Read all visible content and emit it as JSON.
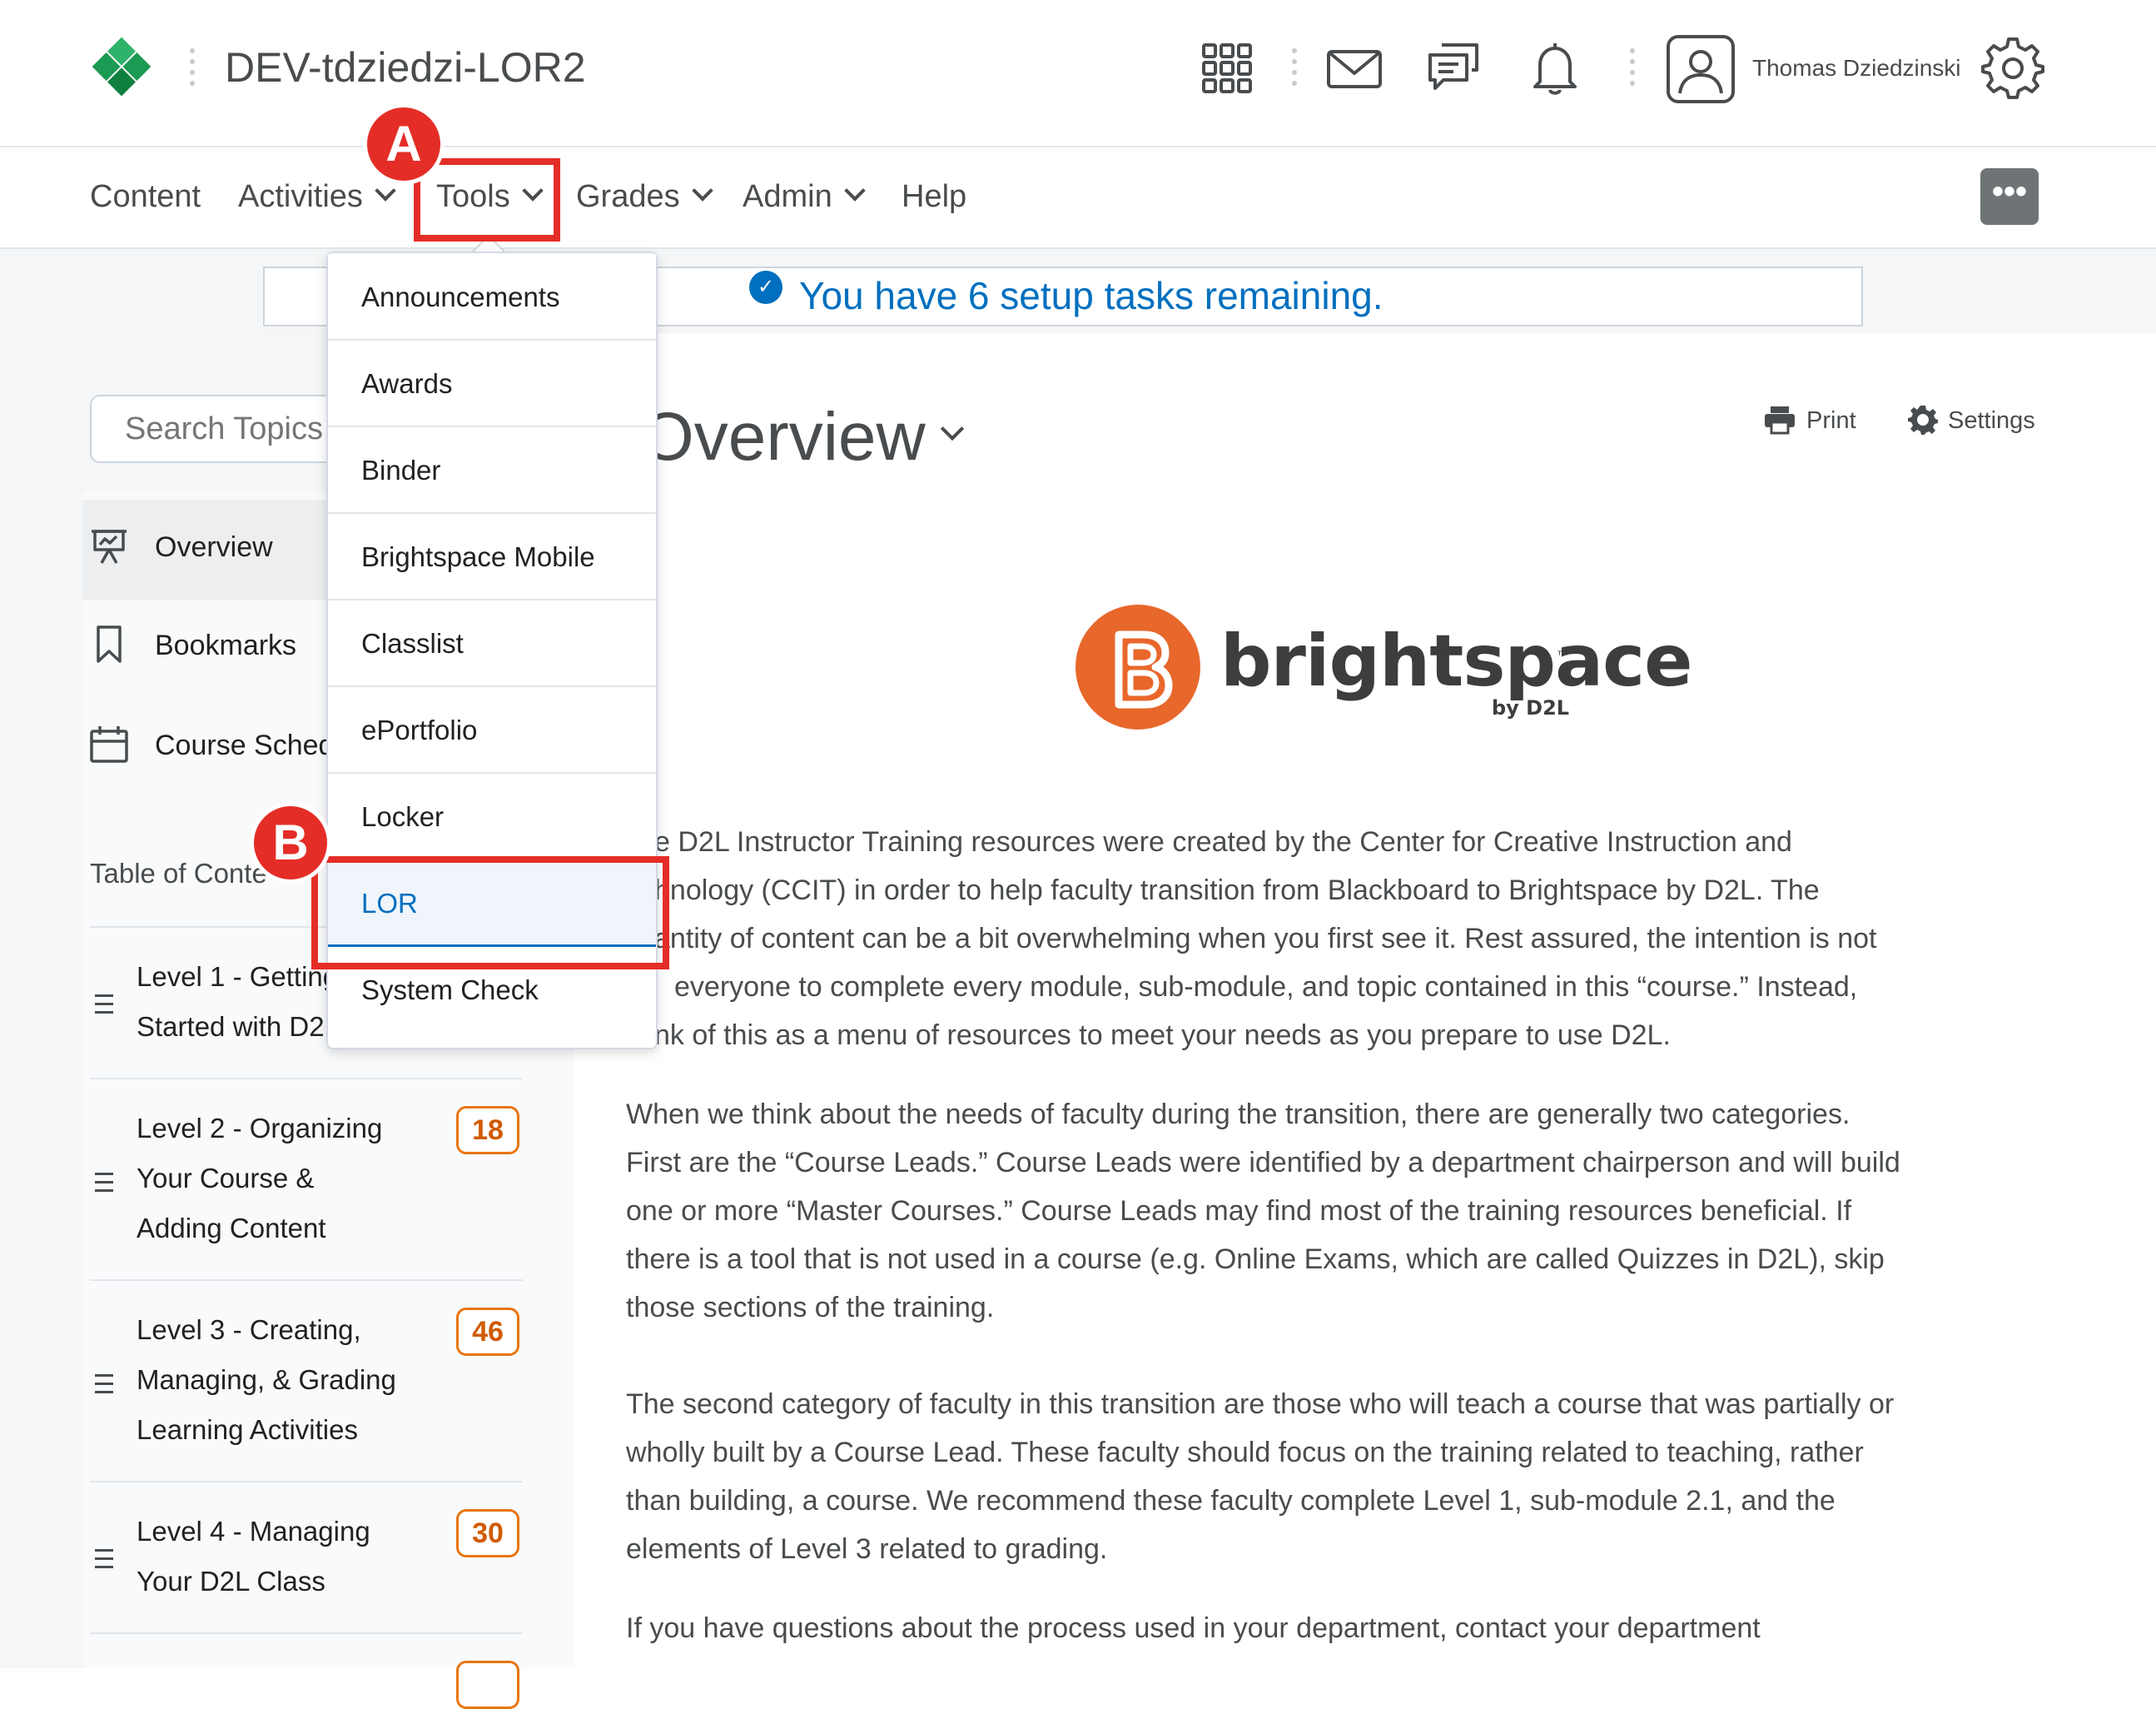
{
  "header": {
    "org_title": "DEV-tdziedzi-LOR2",
    "user_name": "Thomas Dziedzinski",
    "icons": [
      "waffle-icon",
      "mail-icon",
      "chat-icon",
      "bell-icon",
      "avatar-icon",
      "gear-icon"
    ]
  },
  "nav": {
    "items": [
      {
        "label": "Content"
      },
      {
        "label": "Activities"
      },
      {
        "label": "Tools"
      },
      {
        "label": "Grades"
      },
      {
        "label": "Admin"
      },
      {
        "label": "Help"
      }
    ],
    "more_label": "•••"
  },
  "setup_banner": {
    "text": "You have 6 setup tasks remaining."
  },
  "search": {
    "placeholder": "Search Topics"
  },
  "sidebar": {
    "items": [
      {
        "label": "Overview"
      },
      {
        "label": "Bookmarks"
      },
      {
        "label": "Course Schedu"
      }
    ],
    "toc_heading": "Table of Conte",
    "toc": [
      {
        "lines": [
          "Level 1 - Getting",
          "Started with D2"
        ],
        "count": ""
      },
      {
        "lines": [
          "Level 2 - Organizing",
          "Your Course &",
          "Adding Content"
        ],
        "count": "18"
      },
      {
        "lines": [
          "Level 3 - Creating,",
          "Managing, & Grading",
          "Learning Activities"
        ],
        "count": "46"
      },
      {
        "lines": [
          "Level 4 - Managing",
          "Your D2L Class"
        ],
        "count": "30"
      }
    ]
  },
  "main": {
    "heading": "Overview",
    "print_label": "Print",
    "settings_label": "Settings",
    "logo": {
      "word": "brightspace",
      "tm": "™",
      "byline": "by D2L"
    },
    "paragraphs": [
      [
        "e D2L Instructor Training resources were created by the Center for Creative Instruction and",
        "hnology (CCIT) in order to help faculty transition from Blackboard to Brightspace by D2L. The",
        "antity of content can be a bit overwhelming when you first see it. Rest assured, the intention is not",
        "everyone to complete every module, sub-module, and topic contained in this “course.” Instead,",
        "nk of this as a menu of resources to meet your needs as you prepare to use D2L."
      ],
      [
        "When we think about the needs of faculty during the transition, there are generally two categories.",
        "First are the “Course Leads.” Course Leads were identified by a department chairperson and will build",
        "one or more “Master Courses.” Course Leads may find most of the training resources beneficial. If",
        "there is a tool that is not used in a course (e.g. Online Exams, which are called Quizzes in D2L), skip",
        "those sections of the training."
      ],
      [
        "The second category of faculty in this transition are those who will teach a course that was partially or",
        "wholly built by a Course Lead. These faculty should focus on the training related to teaching, rather",
        "than building, a course. We recommend these faculty complete Level 1, sub-module 2.1, and the",
        "elements of Level 3 related to grading."
      ],
      [
        "If you have questions about the process used in your department, contact your department"
      ]
    ]
  },
  "tools_menu": {
    "items": [
      "Announcements",
      "Awards",
      "Binder",
      "Brightspace Mobile",
      "Classlist",
      "ePortfolio",
      "Locker",
      "LOR",
      "System Check"
    ],
    "active_index": 7
  },
  "callouts": {
    "a": "A",
    "b": "B"
  },
  "colors": {
    "accent_blue": "#006fbf",
    "callout_red": "#e52d27",
    "badge_orange": "#e87511",
    "brightspace_orange": "#e8672b"
  }
}
